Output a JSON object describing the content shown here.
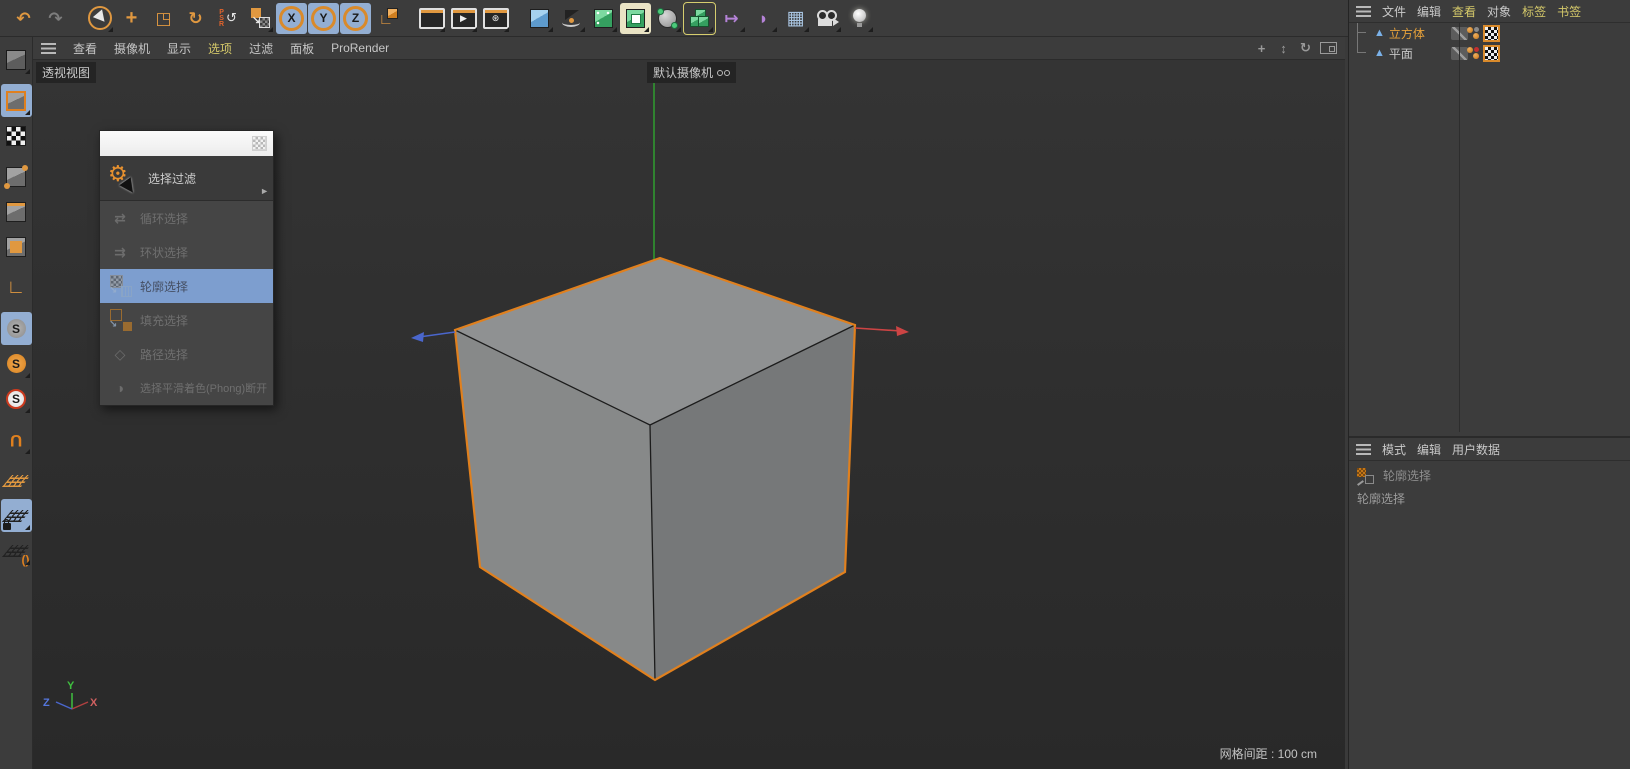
{
  "top_toolbar": {
    "buttons": [
      {
        "name": "undo",
        "glyph": "↶"
      },
      {
        "name": "redo",
        "glyph": "↷"
      },
      {
        "name": "live-selection",
        "glyph": ""
      },
      {
        "name": "move-tool",
        "glyph": "+"
      },
      {
        "name": "scale-tool",
        "glyph": "◳"
      },
      {
        "name": "rotate-tool",
        "glyph": "↻"
      },
      {
        "name": "psr-reset",
        "glyph": "PSR",
        "extra": "↺"
      },
      {
        "name": "coordinate-system",
        "glyph": "↘"
      },
      {
        "name": "axis-x-lock",
        "glyph": "X",
        "selected": true
      },
      {
        "name": "axis-y-lock",
        "glyph": "Y",
        "selected": true
      },
      {
        "name": "axis-z-lock",
        "glyph": "Z",
        "selected": true
      },
      {
        "name": "world-coordinate-system",
        "glyph": "∟"
      },
      {
        "name": "render-view",
        "glyph": ""
      },
      {
        "name": "render-to-picture-viewer",
        "glyph": "▶"
      },
      {
        "name": "render-settings",
        "glyph": "⊛"
      },
      {
        "name": "add-primitive-cube",
        "glyph": ""
      },
      {
        "name": "add-spline-pen",
        "glyph": ""
      },
      {
        "name": "add-subdivision-generator",
        "glyph": ""
      },
      {
        "name": "add-modeling-command",
        "glyph": "",
        "selected": true
      },
      {
        "name": "add-deformer",
        "glyph": ""
      },
      {
        "name": "add-volume-builder",
        "glyph": "",
        "highlighted": true
      },
      {
        "name": "add-motion-graphics",
        "glyph": "↦"
      },
      {
        "name": "add-field",
        "glyph": "◗"
      },
      {
        "name": "add-floor",
        "glyph": "▦"
      },
      {
        "name": "add-camera",
        "glyph": ""
      },
      {
        "name": "add-light",
        "glyph": ""
      }
    ]
  },
  "left_dock": {
    "buttons": [
      {
        "name": "make-editable"
      },
      {
        "name": "model-mode",
        "selected": true
      },
      {
        "name": "texture-mode"
      },
      {
        "name": "points-mode"
      },
      {
        "name": "edges-mode"
      },
      {
        "name": "polygons-mode"
      },
      {
        "name": "enable-axis-mode"
      },
      {
        "name": "enable-snap",
        "glyph": "S",
        "selected": true
      },
      {
        "name": "snap-settings",
        "glyph": "S"
      },
      {
        "name": "quantize-settings",
        "glyph": "S"
      },
      {
        "name": "magnet-tool",
        "glyph": "U"
      },
      {
        "name": "workplane-mode"
      },
      {
        "name": "lock-workplane",
        "selected": true
      },
      {
        "name": "interactive-workplane",
        "glyph": "()"
      }
    ]
  },
  "viewport": {
    "menu": {
      "items": [
        "查看",
        "摄像机",
        "显示",
        "选项",
        "过滤",
        "面板",
        "ProRender"
      ],
      "active": "选项"
    },
    "controls": [
      {
        "name": "pan-view",
        "glyph": "+"
      },
      {
        "name": "dolly-view",
        "glyph": "↕"
      },
      {
        "name": "orbit-view",
        "glyph": "↻"
      },
      {
        "name": "toggle-maximize-view",
        "glyph": ""
      }
    ],
    "view_label": "透视视图",
    "camera_label": "默认摄像机",
    "grid_spacing": "网格间距 : 100 cm",
    "axis_gizmo": {
      "x": "X",
      "y": "Y",
      "z": "Z"
    }
  },
  "context_menu": {
    "header": {
      "label": "选择过滤"
    },
    "items": [
      {
        "label": "循环选择",
        "state": "disabled",
        "glyph": "⇄"
      },
      {
        "label": "环状选择",
        "state": "disabled",
        "glyph": "⇉"
      },
      {
        "label": "轮廓选择",
        "state": "highlighted",
        "glyph": ""
      },
      {
        "label": "填充选择",
        "state": "disabled",
        "glyph": ""
      },
      {
        "label": "路径选择",
        "state": "disabled",
        "glyph": "◇"
      },
      {
        "label": "选择平滑着色(Phong)断开",
        "state": "disabled",
        "glyph": "◑"
      }
    ]
  },
  "object_manager": {
    "menu": [
      "文件",
      "编辑",
      "查看",
      "对象",
      "标签",
      "书签"
    ],
    "objects": [
      {
        "name": "立方体",
        "selected": true
      },
      {
        "name": "平面",
        "selected": false
      }
    ]
  },
  "attribute_manager": {
    "menu": [
      "模式",
      "编辑",
      "用户数据"
    ],
    "tool_title": "轮廓选择",
    "tool_name": "轮廓选择"
  },
  "colors": {
    "accent_orange": "#e09840",
    "selection_blue": "#93aed2",
    "menu_highlight_yellow": "#d5c96a",
    "selected_object_text": "#e8a23a",
    "dropdown_highlight": "#7d9ecf",
    "cube_outline": "#e0801e",
    "axis_x": "#cc5555",
    "axis_y": "#3fbf3f",
    "axis_z": "#5577dd"
  }
}
